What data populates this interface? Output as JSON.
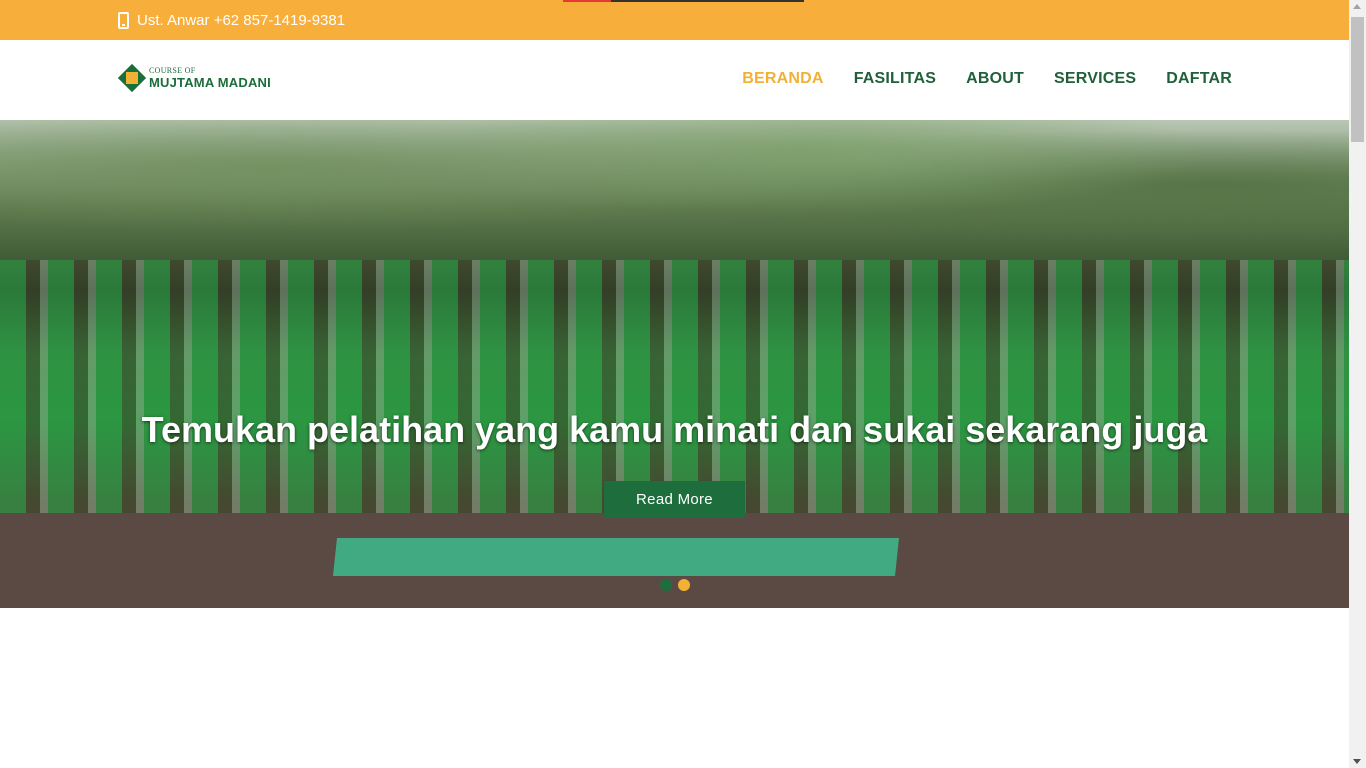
{
  "topbar": {
    "contact": "Ust. Anwar +62 857-1419-9381",
    "bg_color": "#f7ae3b"
  },
  "logo": {
    "small": "COURSE OF",
    "big": "MUJTAMA MADANI"
  },
  "nav": {
    "items": [
      {
        "label": "BERANDA",
        "active": true
      },
      {
        "label": "FASILITAS",
        "active": false
      },
      {
        "label": "ABOUT",
        "active": false
      },
      {
        "label": "SERVICES",
        "active": false
      },
      {
        "label": "DAFTAR",
        "active": false
      }
    ]
  },
  "hero": {
    "title": "Temukan pelatihan yang kamu minati dan sukai sekarang juga",
    "button_label": "Read More",
    "slides": 2,
    "active_slide": 2
  },
  "colors": {
    "accent": "#f2b134",
    "primary": "#1e6e3d"
  }
}
